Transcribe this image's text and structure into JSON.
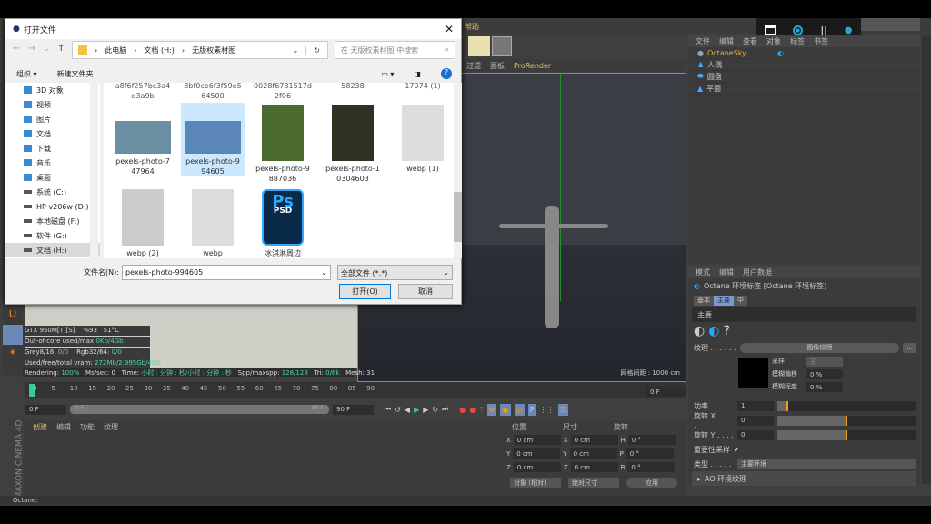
{
  "dialog": {
    "title": "打开文件",
    "breadcrumb": [
      "此电脑",
      "文档 (H:)",
      "无版权素材图"
    ],
    "search_placeholder": "在 无版权素材图 中搜索",
    "organize": "组织 ▾",
    "new_folder": "新建文件夹",
    "nav_items": [
      "3D 对象",
      "视频",
      "图片",
      "文档",
      "下载",
      "音乐",
      "桌面",
      "系统 (C:)",
      "HP v206w (D:)",
      "本地磁盘 (F:)",
      "软件 (G:)",
      "文档 (H:)"
    ],
    "top_row_names": [
      "a8f6f257bc3a4\nd3a9b",
      "8bf0ce6f3f59e5\n64500",
      "0028f6781517d\n2f06",
      "58238",
      "17074 (1)"
    ],
    "files": [
      {
        "name": "pexels-photo-7\n47964",
        "thumb": "#6a8fa0"
      },
      {
        "name": "pexels-photo-9\n94605",
        "thumb": "#5b86b8",
        "selected": true
      },
      {
        "name": "pexels-photo-9\n887036",
        "thumb": "#4a6a30"
      },
      {
        "name": "pexels-photo-1\n0304603",
        "thumb": "#2e3322"
      },
      {
        "name": "webp (1)",
        "thumb": "#ddd"
      },
      {
        "name": "webp (2)",
        "thumb": "#ccc"
      },
      {
        "name": "webp",
        "thumb": "#ddd"
      },
      {
        "name": "冰淇淋周边",
        "thumb": "#0a2a4a",
        "icon": "Ps",
        "sub": "PSD"
      }
    ],
    "filename_label": "文件名(N):",
    "filename_value": "pexels-photo-994605",
    "filetype": "全部文件 (*.*)",
    "open": "打开(O)",
    "cancel": "取消"
  },
  "menu": {
    "help": "帮助"
  },
  "recording": {
    "icons": [
      "window-icon",
      "record-icon",
      "pause-icon",
      "mic-icon"
    ]
  },
  "viewport": {
    "tabs": [
      "过滤",
      "面板",
      "ProRender"
    ],
    "grid_label": "网格间距 : 1000 cm"
  },
  "object_manager": {
    "menu": [
      "文件",
      "编辑",
      "查看",
      "对象",
      "标签",
      "书签"
    ],
    "objects": [
      "OctaneSky",
      "人偶",
      "圆盘",
      "平面"
    ]
  },
  "stats": {
    "gpu": "GTX 950M[T][S]",
    "pct": "%93",
    "temp": "51°C",
    "ooc": "Out-of-core used/max:",
    "ooc_v": "0Kb/4Gb",
    "grey": "Grey8/16: ",
    "grey_v": "0/0",
    "rgb": "Rgb32/64: ",
    "rgb_v": "0/0",
    "vram": "Used/free/total vram: ",
    "vram_v": "272Mb/2.995Gb/4Gb",
    "render": "Rendering: ",
    "render_v": "100%",
    "ms": "Ms/sec: 0",
    "time": "Time: ",
    "time_v": "小时 : 分钟 : 秒/小时 : 分钟 : 秒",
    "spp": "Spp/maxspp: ",
    "spp_v": "128/128",
    "tri": "Tri: ",
    "tri_v": "0/6k",
    "mesh": "Mesh: 31"
  },
  "attributes": {
    "menu": [
      "模式",
      "编辑",
      "用户数据"
    ],
    "title": "Octane 环境标签 [Octane 环境标签]",
    "tabs": [
      "基本",
      "主要",
      "中"
    ],
    "section": "主要",
    "texture_label": "纹理 . . . . . .",
    "texture_btn": "图像纹理",
    "more": "...",
    "sampling": "采样",
    "sampling_v": "无",
    "blur_offset": "模糊偏移",
    "blur_offset_v": "0 %",
    "blur_scale": "模糊程度",
    "blur_scale_v": "0 %",
    "power": "功率 . . . . .",
    "power_v": "1.",
    "power_frac": 0.08,
    "rotx": "旋转 X . . . .",
    "rotx_v": "0",
    "rotx_frac": 0.5,
    "roty": "旋转 Y . . . .",
    "roty_v": "0",
    "roty_frac": 0.5,
    "importance": "重要性采样",
    "type": "类型 . . . . .",
    "type_v": "主要环境",
    "ao": "AO 环境纹理"
  },
  "timeline": {
    "ticks": [
      "0",
      "5",
      "10",
      "15",
      "20",
      "25",
      "30",
      "35",
      "40",
      "45",
      "50",
      "55",
      "60",
      "65",
      "70",
      "75",
      "80",
      "85",
      "90"
    ],
    "current": "0 F",
    "start": "0 F",
    "range_start": "0 F",
    "range_end": "90 F",
    "end": "90 F"
  },
  "material_manager": {
    "menu": [
      "创建",
      "编辑",
      "功能",
      "纹理"
    ]
  },
  "coords": {
    "headers": [
      "位置",
      "尺寸",
      "旋转"
    ],
    "rows": [
      [
        "X",
        "0 cm",
        "X",
        "0 cm",
        "H",
        "0 °"
      ],
      [
        "Y",
        "0 cm",
        "Y",
        "0 cm",
        "P",
        "0 °"
      ],
      [
        "Z",
        "0 cm",
        "Z",
        "0 cm",
        "B",
        "0 °"
      ]
    ],
    "mode": "对象 (相对)",
    "size_mode": "绝对尺寸",
    "apply": "应用"
  },
  "brand": "MAXON CINEMA 4D",
  "status": "Octane:"
}
